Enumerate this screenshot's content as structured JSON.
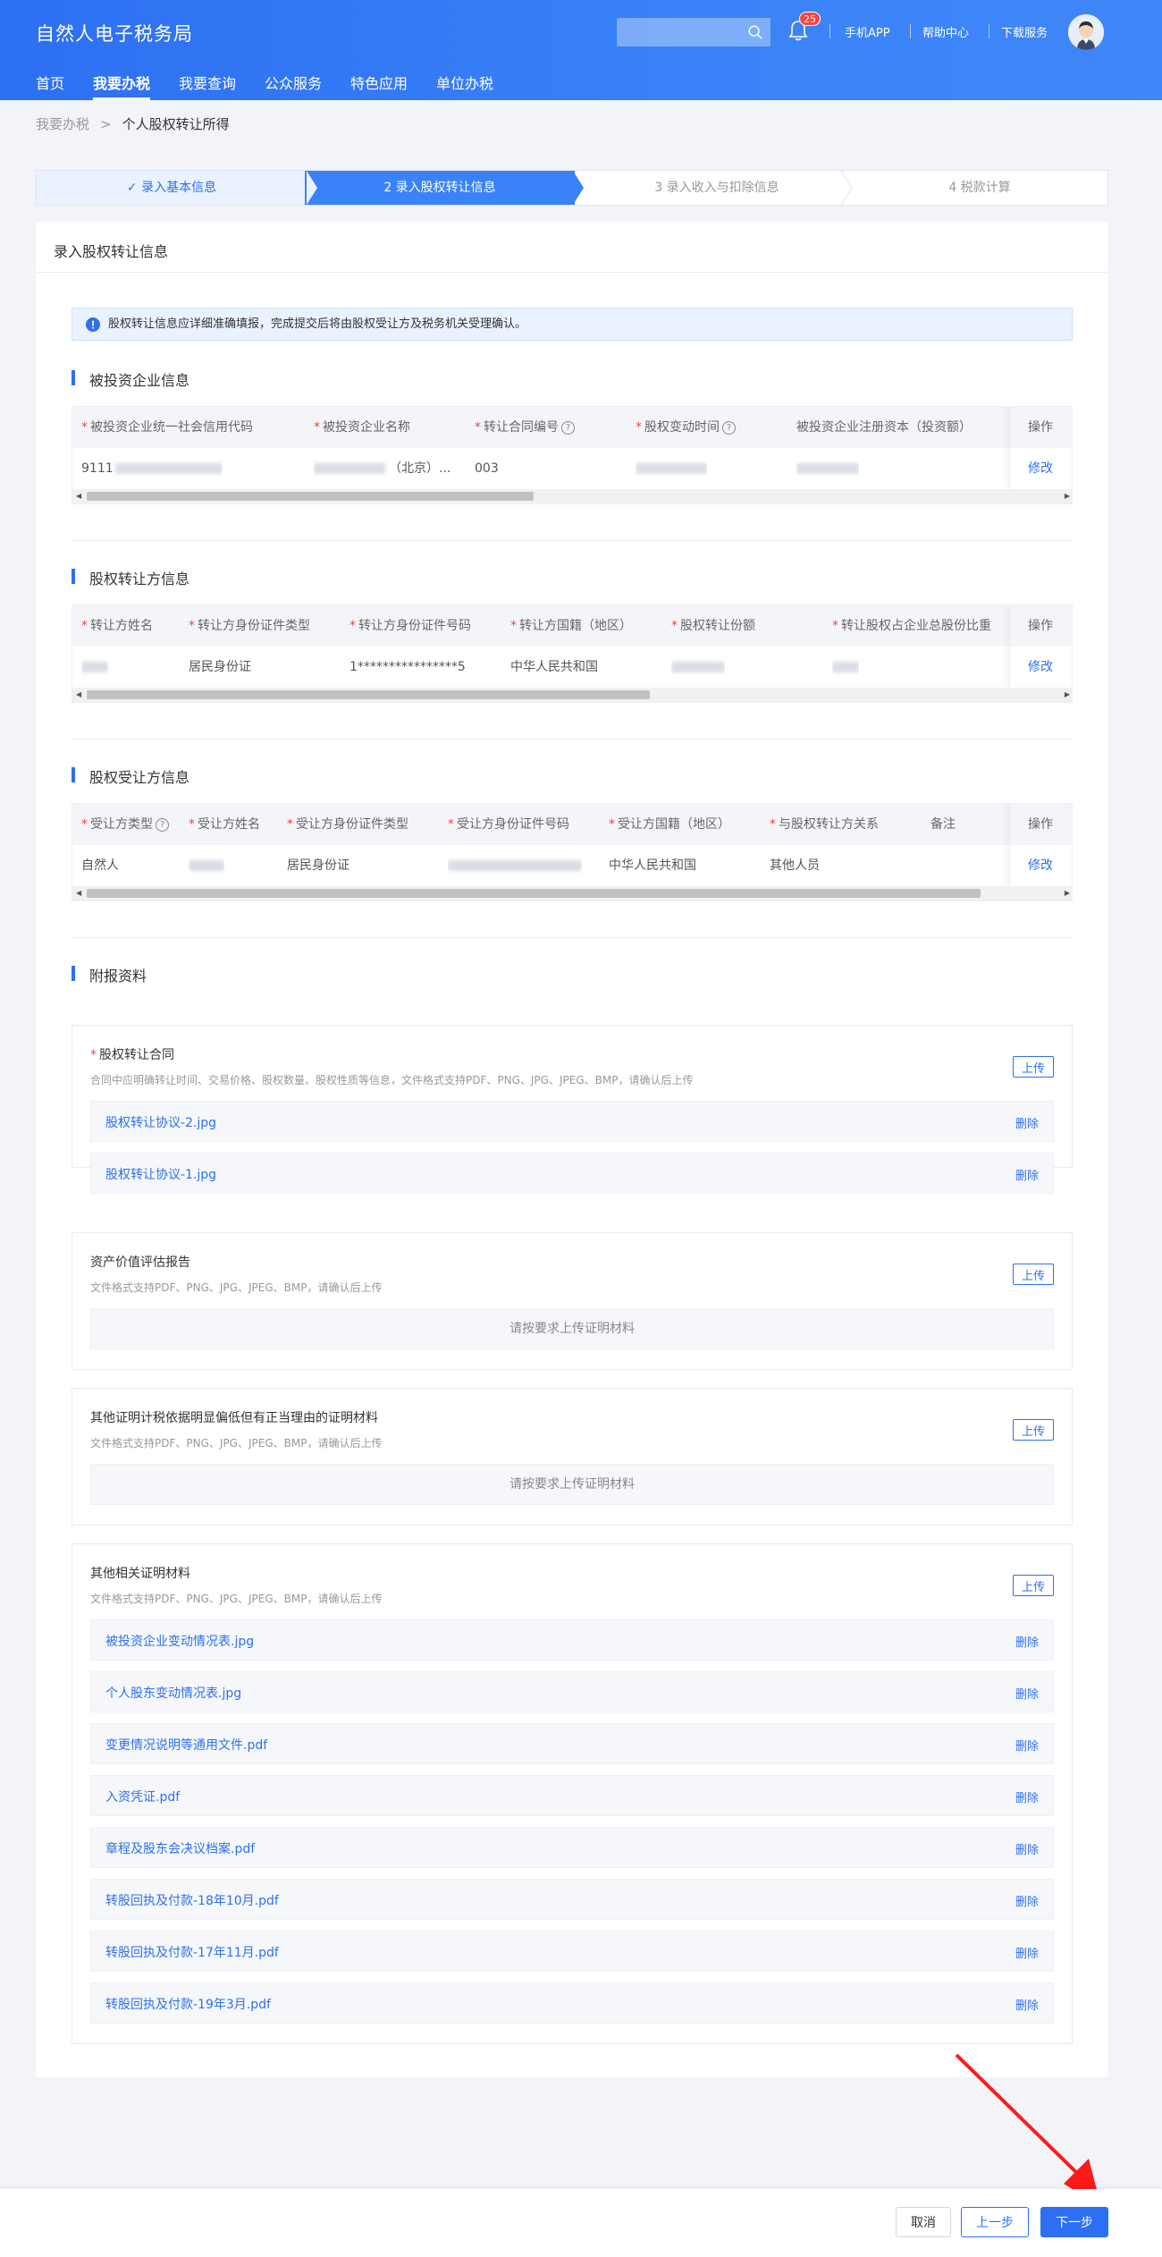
{
  "header": {
    "brand": "自然人电子税务局",
    "search_placeholder": "",
    "notification_count": "25",
    "links": [
      "手机APP",
      "帮助中心",
      "下载服务"
    ],
    "nav": [
      "首页",
      "我要办税",
      "我要查询",
      "公众服务",
      "特色应用",
      "单位办税"
    ],
    "active_nav": "我要办税"
  },
  "breadcrumb": {
    "parent": "我要办税",
    "current": "个人股权转让所得"
  },
  "steps": [
    {
      "label": "✓ 录入基本信息",
      "state": "done"
    },
    {
      "label": "2  录入股权转让信息",
      "state": "active"
    },
    {
      "label": "3  录入收入与扣除信息",
      "state": "pending"
    },
    {
      "label": "4  税款计算",
      "state": "pending"
    }
  ],
  "card": {
    "title": "录入股权转让信息",
    "notice": "股权转让信息应详细准确填报，完成提交后将由股权受让方及税务机关受理确认。"
  },
  "sections": {
    "invested": {
      "title": "被投资企业信息",
      "headers": [
        "被投资企业统一社会信用代码",
        "被投资企业名称",
        "转让合同编号",
        "股权变动时间",
        "被投资企业注册资本（投资额）"
      ],
      "required": [
        true,
        true,
        true,
        true,
        false
      ],
      "help": [
        false,
        false,
        true,
        true,
        false
      ],
      "row": [
        "9111",
        "（北京）...",
        "003",
        "",
        ""
      ],
      "op_header": "操作",
      "op_label": "修改"
    },
    "transferor": {
      "title": "股权转让方信息",
      "headers": [
        "转让方姓名",
        "转让方身份证件类型",
        "转让方身份证件号码",
        "转让方国籍（地区）",
        "股权转让份额",
        "转让股权占企业总股份比重"
      ],
      "row": [
        "",
        "居民身份证",
        "1****************5",
        "中华人民共和国",
        "",
        ""
      ],
      "op_header": "操作",
      "op_label": "修改"
    },
    "transferee": {
      "title": "股权受让方信息",
      "headers": [
        "受让方类型",
        "受让方姓名",
        "受让方身份证件类型",
        "受让方身份证件号码",
        "受让方国籍（地区）",
        "与股权转让方关系",
        "备注"
      ],
      "required": [
        true,
        true,
        true,
        true,
        true,
        true,
        false
      ],
      "row": [
        "自然人",
        "",
        "居民身份证",
        "",
        "中华人民共和国",
        "其他人员",
        ""
      ],
      "op_header": "操作",
      "op_label": "修改"
    },
    "attachments": {
      "title": "附报资料",
      "upload_label": "上传",
      "delete_label": "删除",
      "empty_text": "请按要求上传证明材料",
      "groups": [
        {
          "title": "股权转让合同",
          "required": true,
          "desc": "合同中应明确转让时间、交易价格、股权数量、股权性质等信息，文件格式支持PDF、PNG、JPG、JPEG、BMP，请确认后上传",
          "files": [
            "股权转让协议-2.jpg",
            "股权转让协议-1.jpg"
          ]
        },
        {
          "title": "资产价值评估报告",
          "required": false,
          "desc": "文件格式支持PDF、PNG、JPG、JPEG、BMP，请确认后上传",
          "files": []
        },
        {
          "title": "其他证明计税依据明显偏低但有正当理由的证明材料",
          "required": false,
          "desc": "文件格式支持PDF、PNG、JPG、JPEG、BMP，请确认后上传",
          "files": []
        },
        {
          "title": "其他相关证明材料",
          "required": false,
          "desc": "文件格式支持PDF、PNG、JPG、JPEG、BMP，请确认后上传",
          "files": [
            "被投资企业变动情况表.jpg",
            "个人股东变动情况表.jpg",
            "变更情况说明等通用文件.pdf",
            "入资凭证.pdf",
            "章程及股东会决议档案.pdf",
            "转股回执及付款-18年10月.pdf",
            "转股回执及付款-17年11月.pdf",
            "转股回执及付款-19年3月.pdf"
          ]
        }
      ]
    }
  },
  "footer": {
    "cancel": "取消",
    "prev": "上一步",
    "next": "下一步"
  },
  "colors": {
    "primary": "#2d6ff2",
    "required": "#f5453d",
    "annotation_arrow": "#ff1a1a"
  }
}
